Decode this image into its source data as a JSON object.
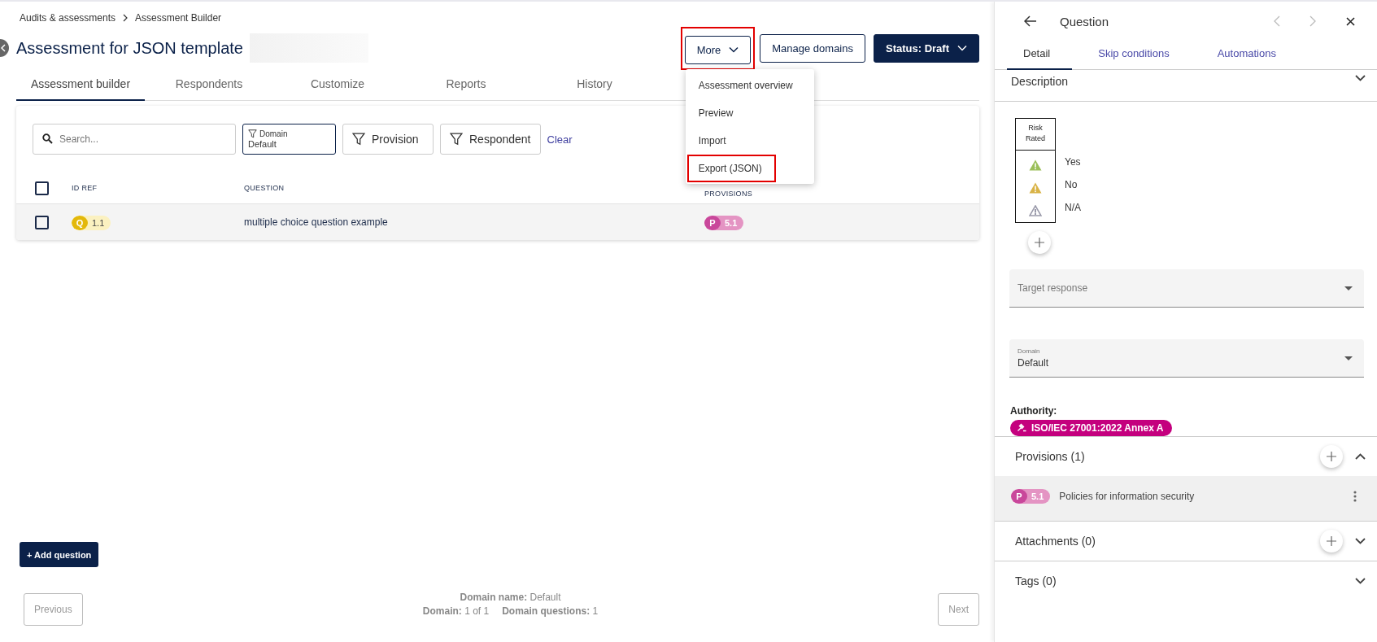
{
  "breadcrumb": [
    {
      "label": "Audits & assessments"
    },
    {
      "label": "Assessment Builder"
    }
  ],
  "title": "Assessment for JSON template",
  "actions": {
    "more": {
      "label": "More",
      "highlighted": true,
      "expanded": true
    },
    "manage": "Manage domains",
    "status": "Status: Draft"
  },
  "more_menu": [
    {
      "label": "Assessment overview",
      "highlighted": false
    },
    {
      "label": "Preview",
      "highlighted": false
    },
    {
      "label": "Import",
      "highlighted": false
    },
    {
      "label": "Export (JSON)",
      "highlighted": true
    }
  ],
  "tabs": [
    {
      "label": "Assessment builder",
      "selected": true
    },
    {
      "label": "Respondents",
      "selected": false
    },
    {
      "label": "Customize",
      "selected": false
    },
    {
      "label": "Reports",
      "selected": false
    },
    {
      "label": "History",
      "selected": false
    }
  ],
  "search": {
    "placeholder": "Search..."
  },
  "filters": [
    {
      "label": "Domain",
      "value": "Default",
      "active": true
    },
    {
      "label": "Provision",
      "active": false
    },
    {
      "label": "Respondent",
      "active": false
    }
  ],
  "clear": "Clear",
  "table": {
    "columns": [
      "ID REF",
      "QUESTION",
      "PROVISIONS"
    ],
    "select_all_checked": false,
    "rows": [
      {
        "checked": false,
        "type_badge": "Q",
        "id_ref": "1.1",
        "question": "multiple choice question example",
        "provision_badge": "P",
        "provision_ref": "5.1"
      }
    ]
  },
  "add_question": "+ Add question",
  "pagination": {
    "previous": {
      "label": "Previous",
      "disabled": true
    },
    "next": {
      "label": "Next",
      "disabled": true
    },
    "info": [
      "**Domain name:** Default",
      "**Domain:** 1 of 1",
      "**Domain questions:** 1"
    ]
  },
  "panel": {
    "title": "Question",
    "tabs": [
      {
        "label": "Detail",
        "selected": true
      },
      {
        "label": "Skip conditions",
        "selected": false
      },
      {
        "label": "Automations",
        "selected": false
      }
    ],
    "description": {
      "label": "Description",
      "expanded": false
    },
    "risk": {
      "header": "Risk Rated",
      "rows": [
        {
          "label": "Yes",
          "kind": "filled",
          "color": "#9bbf5a"
        },
        {
          "label": "No",
          "kind": "filled",
          "color": "#d9b347"
        },
        {
          "label": "N/A",
          "kind": "outline",
          "color": "#9a9aaa"
        }
      ]
    },
    "target_response": {
      "placeholder": "Target response"
    },
    "domain": {
      "label": "Domain",
      "value": "Default"
    },
    "authority": {
      "label": "Authority:",
      "chip": "ISO/IEC 27001:2022 Annex A"
    },
    "sections": [
      {
        "title": "Provisions (1)",
        "expanded": true,
        "addable": true,
        "items": [
          {
            "badge": "P",
            "ref": "5.1",
            "text": "Policies for information security"
          }
        ]
      },
      {
        "title": "Attachments (0)",
        "expanded": false,
        "addable": true
      },
      {
        "title": "Tags (0)",
        "expanded": false,
        "addable": false
      }
    ]
  }
}
